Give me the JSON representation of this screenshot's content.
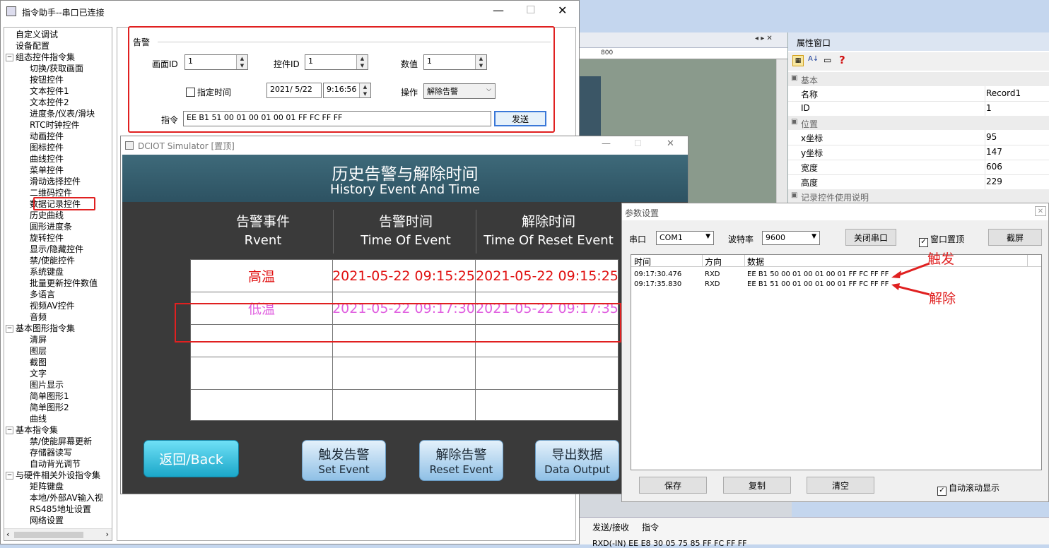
{
  "main": {
    "title": "指令助手--串口已连接",
    "tree": [
      {
        "label": "自定义调试",
        "level": 0
      },
      {
        "label": "设备配置",
        "level": 0
      },
      {
        "label": "组态控件指令集",
        "level": 0,
        "toggle": "−"
      },
      {
        "label": "切换/获取画面",
        "level": 1
      },
      {
        "label": "按钮控件",
        "level": 1
      },
      {
        "label": "文本控件1",
        "level": 1
      },
      {
        "label": "文本控件2",
        "level": 1
      },
      {
        "label": "进度条/仪表/滑块",
        "level": 1
      },
      {
        "label": "RTC时钟控件",
        "level": 1
      },
      {
        "label": "动画控件",
        "level": 1
      },
      {
        "label": "图标控件",
        "level": 1
      },
      {
        "label": "曲线控件",
        "level": 1
      },
      {
        "label": "菜单控件",
        "level": 1
      },
      {
        "label": "滑动选择控件",
        "level": 1
      },
      {
        "label": "二维码控件",
        "level": 1
      },
      {
        "label": "数据记录控件",
        "level": 1
      },
      {
        "label": "历史曲线",
        "level": 1
      },
      {
        "label": "圆形进度条",
        "level": 1
      },
      {
        "label": "旋转控件",
        "level": 1
      },
      {
        "label": "显示/隐藏控件",
        "level": 1
      },
      {
        "label": "禁/使能控件",
        "level": 1
      },
      {
        "label": "系统键盘",
        "level": 1
      },
      {
        "label": "批量更新控件数值",
        "level": 1
      },
      {
        "label": "多语言",
        "level": 1
      },
      {
        "label": "视频AV控件",
        "level": 1
      },
      {
        "label": "音频",
        "level": 1
      },
      {
        "label": "基本图形指令集",
        "level": 0,
        "toggle": "−"
      },
      {
        "label": "清屏",
        "level": 1
      },
      {
        "label": "图层",
        "level": 1
      },
      {
        "label": "截图",
        "level": 1
      },
      {
        "label": "文字",
        "level": 1
      },
      {
        "label": "图片显示",
        "level": 1
      },
      {
        "label": "简单图形1",
        "level": 1
      },
      {
        "label": "简单图形2",
        "level": 1
      },
      {
        "label": "曲线",
        "level": 1
      },
      {
        "label": "基本指令集",
        "level": 0,
        "toggle": "−"
      },
      {
        "label": "禁/使能屏幕更新",
        "level": 1
      },
      {
        "label": "存储器读写",
        "level": 1
      },
      {
        "label": "自动背光调节",
        "level": 1
      },
      {
        "label": "与硬件相关外设指令集",
        "level": 0,
        "toggle": "−"
      },
      {
        "label": "矩阵键盘",
        "level": 1
      },
      {
        "label": "本地/外部AV输入视",
        "level": 1
      },
      {
        "label": "RS485地址设置",
        "level": 1
      },
      {
        "label": "网络设置",
        "level": 1
      }
    ],
    "group": "告警",
    "screen_id_label": "画面ID",
    "screen_id": "1",
    "ctrl_id_label": "控件ID",
    "ctrl_id": "1",
    "value_label": "数值",
    "value": "1",
    "time_check": "指定时间",
    "date": "2021/ 5/22",
    "time": "9:16:56",
    "op_label": "操作",
    "op_value": "解除告警",
    "cmd_label": "指令",
    "cmd": "EE B1 51 00 01 00 01 00 01 FF FC FF FF",
    "send": "发送"
  },
  "sim": {
    "title": "DCIOT Simulator [置顶]",
    "heading_cn": "历史告警与解除时间",
    "heading_en": "History Event And Time",
    "col1_cn": "告警事件",
    "col1_en": "Rvent",
    "col2_cn": "告警时间",
    "col2_en": "Time Of Event",
    "col3_cn": "解除时间",
    "col3_en": "Time Of Reset Event",
    "rows": [
      {
        "event": "高温",
        "time": "2021-05-22 09:15:25",
        "reset": "2021-05-22 09:15:25",
        "color": "#e01010"
      },
      {
        "event": "低温",
        "time": "2021-05-22 09:17:30",
        "reset": "2021-05-22 09:17:35",
        "color": "#e060e0"
      }
    ],
    "back": "返回/Back",
    "btn1_cn": "触发告警",
    "btn1_en": "Set Event",
    "btn2_cn": "解除告警",
    "btn2_en": "Reset Event",
    "btn3_cn": "导出数据",
    "btn3_en": "Data Output"
  },
  "props": {
    "title": "属性窗口",
    "sec_basic": "基本",
    "name_k": "名称",
    "name_v": "Record1",
    "id_k": "ID",
    "id_v": "1",
    "sec_pos": "位置",
    "x_k": "x坐标",
    "x_v": "95",
    "y_k": "y坐标",
    "y_v": "147",
    "w_k": "宽度",
    "w_v": "606",
    "h_k": "高度",
    "h_v": "229",
    "sec_note": "记录控件使用说明"
  },
  "ruler": "800",
  "params": {
    "title": "参数设置",
    "port_label": "串口",
    "port": "COM1",
    "baud_label": "波特率",
    "baud": "9600",
    "close_port": "关闭串口",
    "topmost": "窗口置顶",
    "screenshot": "截屏",
    "col_time": "时间",
    "col_dir": "方向",
    "col_data": "数据",
    "log": [
      {
        "time": "09:17:30.476",
        "dir": "RXD",
        "data": "EE B1 50 00 01 00 01 00 01 FF FC FF FF"
      },
      {
        "time": "09:17:35.830",
        "dir": "RXD",
        "data": "EE B1 51 00 01 00 01 00 01 FF FC FF FF"
      }
    ],
    "trigger": "触发",
    "release": "解除",
    "save": "保存",
    "copy": "复制",
    "clear": "清空",
    "autoscroll": "自动滚动显示"
  },
  "bottom": {
    "tab": "发送/接收",
    "tab2": "指令",
    "line": "RXD(-IN)    EE E8 30 05 75 85 FF FC FF FF"
  }
}
